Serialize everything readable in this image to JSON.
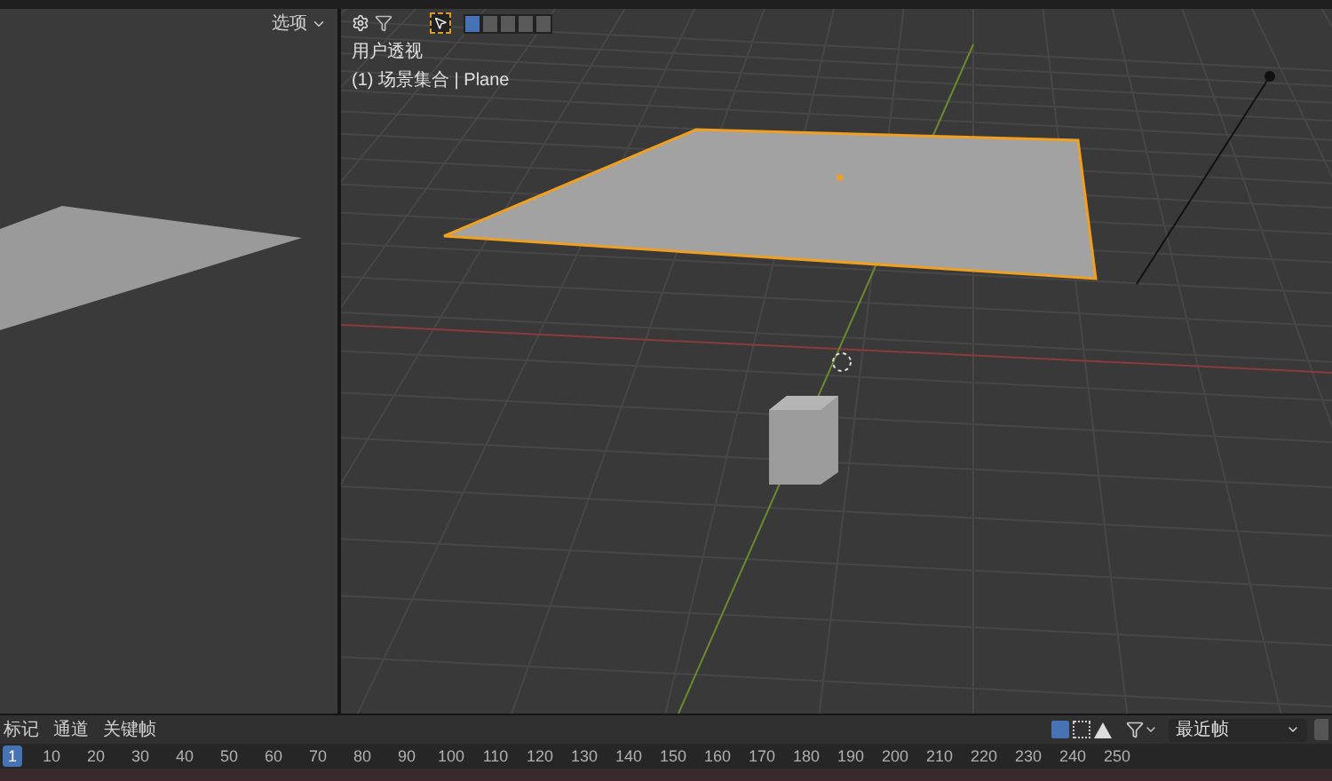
{
  "left_panel": {
    "dropdown": "选项"
  },
  "viewport": {
    "tools": [
      {
        "selected": true
      }
    ],
    "select_modes": [
      {
        "selected": true
      },
      {
        "selected": false
      },
      {
        "selected": false
      },
      {
        "selected": false
      },
      {
        "selected": false
      }
    ],
    "view_name": "用户透视",
    "object_info": "(1) 场景集合 | Plane"
  },
  "timeline": {
    "menus": [
      "标记",
      "通道",
      "关键帧"
    ],
    "sync_dropdown": "最近帧",
    "frames": [
      {
        "label": "1",
        "selected": true
      },
      {
        "label": "10",
        "selected": false
      },
      {
        "label": "20",
        "selected": false
      },
      {
        "label": "30",
        "selected": false
      },
      {
        "label": "40",
        "selected": false
      },
      {
        "label": "50",
        "selected": false
      },
      {
        "label": "60",
        "selected": false
      },
      {
        "label": "70",
        "selected": false
      },
      {
        "label": "80",
        "selected": false
      },
      {
        "label": "90",
        "selected": false
      },
      {
        "label": "100",
        "selected": false
      },
      {
        "label": "110",
        "selected": false
      },
      {
        "label": "120",
        "selected": false
      },
      {
        "label": "130",
        "selected": false
      },
      {
        "label": "140",
        "selected": false
      },
      {
        "label": "150",
        "selected": false
      },
      {
        "label": "160",
        "selected": false
      },
      {
        "label": "170",
        "selected": false
      },
      {
        "label": "180",
        "selected": false
      },
      {
        "label": "190",
        "selected": false
      },
      {
        "label": "200",
        "selected": false
      },
      {
        "label": "210",
        "selected": false
      },
      {
        "label": "220",
        "selected": false
      },
      {
        "label": "230",
        "selected": false
      },
      {
        "label": "240",
        "selected": false
      },
      {
        "label": "250",
        "selected": false
      }
    ]
  }
}
